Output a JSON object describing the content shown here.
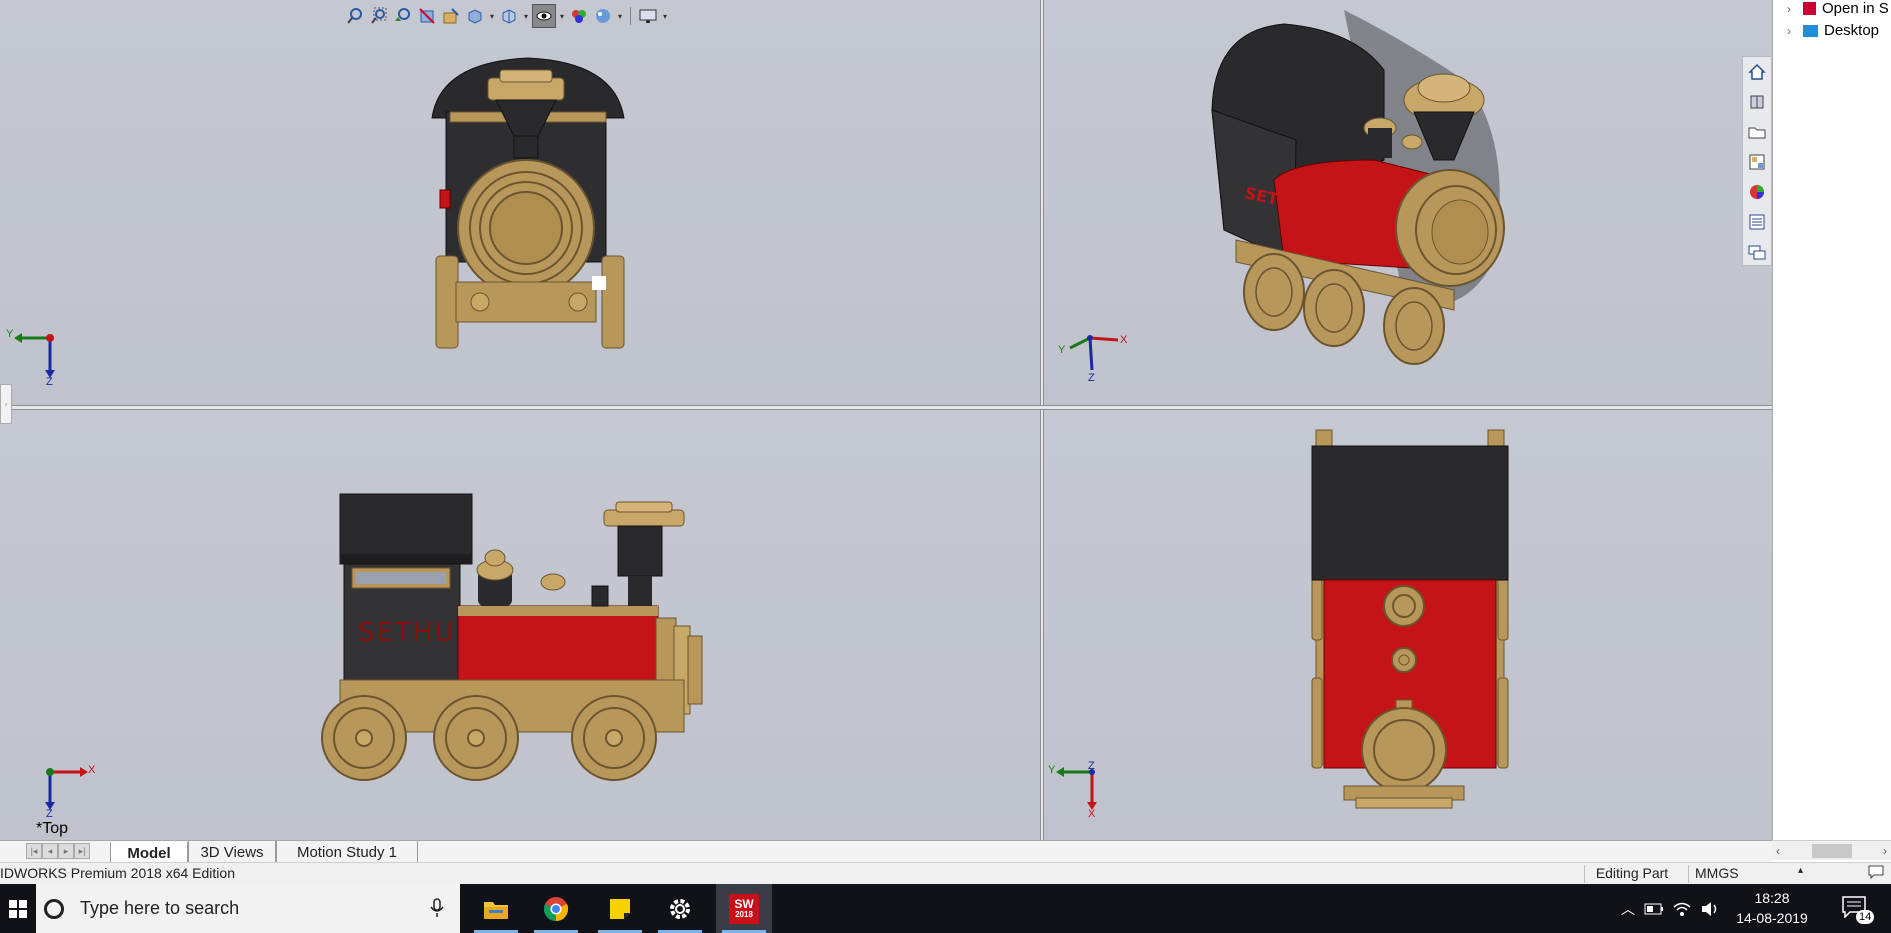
{
  "app": {
    "edition": "IDWORKS Premium 2018 x64 Edition"
  },
  "hud_toolbar": {
    "items": [
      "zoom-to-fit-icon",
      "zoom-to-area-icon",
      "previous-view-icon",
      "section-view-icon",
      "dynamic-annotation-icon",
      "view-orientation-icon",
      "display-style-icon",
      "hide-show-items-icon",
      "edit-appearance-icon",
      "apply-scene-icon",
      "view-settings-icon"
    ]
  },
  "viewports": {
    "front": {
      "triad": {
        "y": "Y",
        "z": "Z"
      }
    },
    "iso": {
      "triad": {
        "y": "Y",
        "z": "Z",
        "x": "X"
      }
    },
    "side": {
      "triad": {
        "x": "X",
        "z": "Z"
      },
      "view_label": "*Top",
      "nameplate": "SETHU"
    },
    "top": {
      "triad": {
        "y": "Y",
        "z": "Z",
        "x": "X"
      }
    }
  },
  "colors": {
    "black": "#2a2a2c",
    "gold": "#b8975a",
    "red": "#c41418",
    "background": "#c3c6ce"
  },
  "bottom_tabs": [
    "Model",
    "3D Views",
    "Motion Study 1"
  ],
  "statusbar": {
    "mode": "Editing Part",
    "units": "MMGS"
  },
  "right_panel": {
    "tree": [
      {
        "label": "Open in S"
      },
      {
        "label": "Desktop"
      }
    ]
  },
  "task_pane": [
    "home-icon",
    "3d-content-icon",
    "file-explorer-icon",
    "view-palette-icon",
    "appearances-icon",
    "custom-properties-icon",
    "forum-icon"
  ],
  "taskbar": {
    "search_placeholder": "Type here to search",
    "apps": [
      "file-explorer",
      "chrome",
      "sticky-notes",
      "settings",
      "solidworks"
    ],
    "solidworks_badge": "SW",
    "solidworks_year": "2018",
    "time": "18:28",
    "date": "14-08-2019",
    "notifications": "14"
  }
}
